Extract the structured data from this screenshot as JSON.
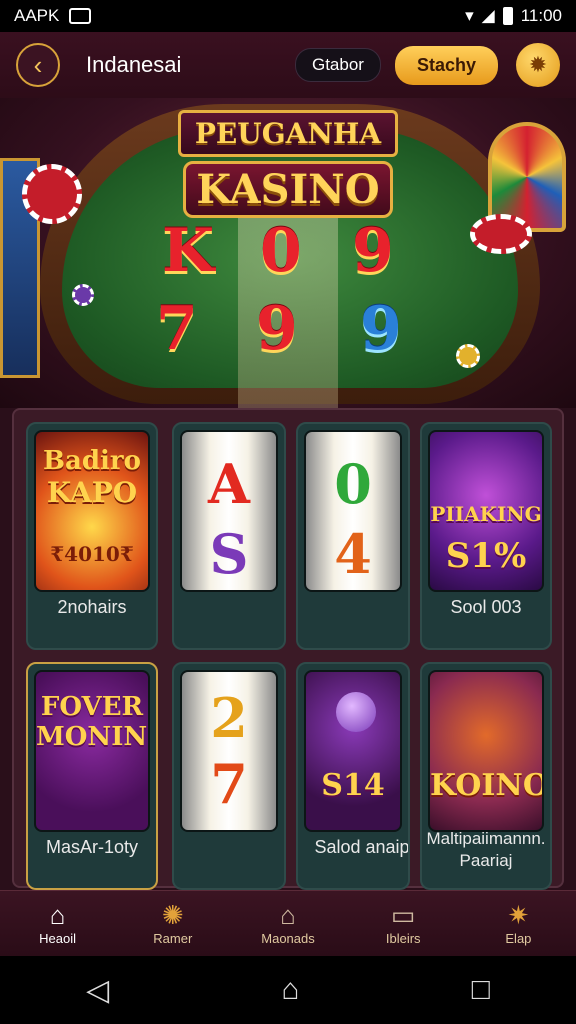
{
  "status": {
    "app": "AAPK",
    "time": "11:00"
  },
  "header": {
    "title": "Indanesai",
    "dark_pill": "Gtabor",
    "gold_pill": "Stachy",
    "back_icon": "chevron-left-icon",
    "coin_icon": "coin-icon"
  },
  "hero": {
    "sign_line1": "PEUGANHA",
    "sign_line2": "KASINO",
    "symbols_row1": [
      "K",
      "0",
      "9"
    ],
    "symbols_row2": [
      "7",
      "9",
      "9"
    ]
  },
  "games": [
    {
      "art_lines": [
        "Badiro",
        "KAPO",
        "₹4010₹"
      ],
      "label": "2nohairs"
    },
    {
      "art_lines": [
        "A",
        "S"
      ],
      "label": ""
    },
    {
      "art_lines": [
        "0",
        "4"
      ],
      "label": ""
    },
    {
      "art_lines": [
        "PIIAKING",
        "S1%"
      ],
      "label": "Sool 003"
    },
    {
      "art_lines": [
        "FOVER",
        "MONING"
      ],
      "label": "MasAr-1oty"
    },
    {
      "art_lines": [
        "2",
        "7"
      ],
      "label": ""
    },
    {
      "art_lines": [
        "S14"
      ],
      "label": "Salod anaip"
    },
    {
      "art_lines": [
        "KOINO"
      ],
      "label": "Maltipaiimannn. Paariaj"
    }
  ],
  "nav": [
    {
      "label": "Heaoil",
      "icon": "home-icon"
    },
    {
      "label": "Ramer",
      "icon": "gear-ring-icon"
    },
    {
      "label": "Maonads",
      "icon": "gift-box-icon"
    },
    {
      "label": "Ibleirs",
      "icon": "ticket-icon"
    },
    {
      "label": "Elap",
      "icon": "settings-gear-icon"
    }
  ],
  "colors": {
    "accent_gold": "#e7b041",
    "bg": "#2a0f1a",
    "felt": "#1e5a24"
  }
}
